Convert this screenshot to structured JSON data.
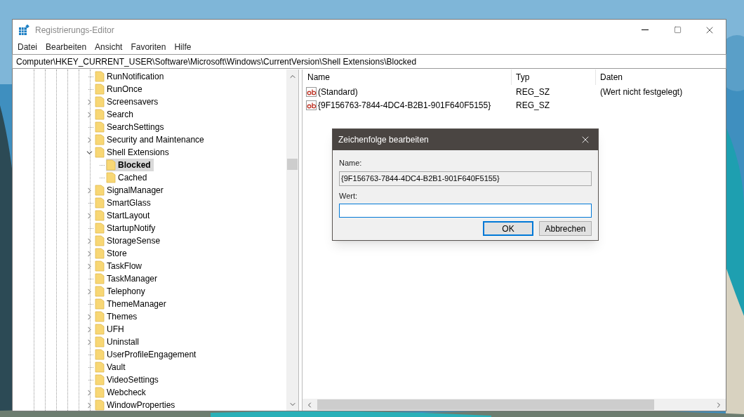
{
  "window": {
    "title": "Registrierungs-Editor"
  },
  "menu": [
    "Datei",
    "Bearbeiten",
    "Ansicht",
    "Favoriten",
    "Hilfe"
  ],
  "address": "Computer\\HKEY_CURRENT_USER\\Software\\Microsoft\\Windows\\CurrentVersion\\Shell Extensions\\Blocked",
  "tree": [
    {
      "label": "RunNotification",
      "kind": "leaf",
      "selected": false
    },
    {
      "label": "RunOnce",
      "kind": "leaf",
      "selected": false
    },
    {
      "label": "Screensavers",
      "kind": "collapsed",
      "selected": false
    },
    {
      "label": "Search",
      "kind": "collapsed",
      "selected": false
    },
    {
      "label": "SearchSettings",
      "kind": "leaf",
      "selected": false
    },
    {
      "label": "Security and Maintenance",
      "kind": "collapsed",
      "selected": false
    },
    {
      "label": "Shell Extensions",
      "kind": "expanded",
      "selected": false,
      "children": [
        {
          "label": "Blocked",
          "kind": "leaf",
          "selected": true
        },
        {
          "label": "Cached",
          "kind": "leaf",
          "selected": false
        }
      ]
    },
    {
      "label": "SignalManager",
      "kind": "collapsed",
      "selected": false
    },
    {
      "label": "SmartGlass",
      "kind": "leaf",
      "selected": false
    },
    {
      "label": "StartLayout",
      "kind": "collapsed",
      "selected": false
    },
    {
      "label": "StartupNotify",
      "kind": "leaf",
      "selected": false
    },
    {
      "label": "StorageSense",
      "kind": "collapsed",
      "selected": false
    },
    {
      "label": "Store",
      "kind": "collapsed",
      "selected": false
    },
    {
      "label": "TaskFlow",
      "kind": "collapsed",
      "selected": false
    },
    {
      "label": "TaskManager",
      "kind": "leaf",
      "selected": false
    },
    {
      "label": "Telephony",
      "kind": "collapsed",
      "selected": false
    },
    {
      "label": "ThemeManager",
      "kind": "leaf",
      "selected": false
    },
    {
      "label": "Themes",
      "kind": "collapsed",
      "selected": false
    },
    {
      "label": "UFH",
      "kind": "collapsed",
      "selected": false
    },
    {
      "label": "Uninstall",
      "kind": "collapsed",
      "selected": false
    },
    {
      "label": "UserProfileEngagement",
      "kind": "leaf",
      "selected": false
    },
    {
      "label": "Vault",
      "kind": "leaf",
      "selected": false
    },
    {
      "label": "VideoSettings",
      "kind": "leaf",
      "selected": false
    },
    {
      "label": "Webcheck",
      "kind": "collapsed",
      "selected": false
    },
    {
      "label": "WindowProperties",
      "kind": "collapsed",
      "selected": false
    }
  ],
  "table": {
    "columns": [
      "Name",
      "Typ",
      "Daten"
    ],
    "rows": [
      {
        "name": "(Standard)",
        "type": "REG_SZ",
        "data": "(Wert nicht festgelegt)"
      },
      {
        "name": "{9F156763-7844-4DC4-B2B1-901F640F5155}",
        "type": "REG_SZ"
      }
    ]
  },
  "dialog": {
    "title": "Zeichenfolge bearbeiten",
    "name_label": "Name:",
    "name_value": "{9F156763-7844-4DC4-B2B1-901F640F5155}",
    "value_label": "Wert:",
    "buttons": [
      "OK",
      "Abbrechen"
    ]
  }
}
